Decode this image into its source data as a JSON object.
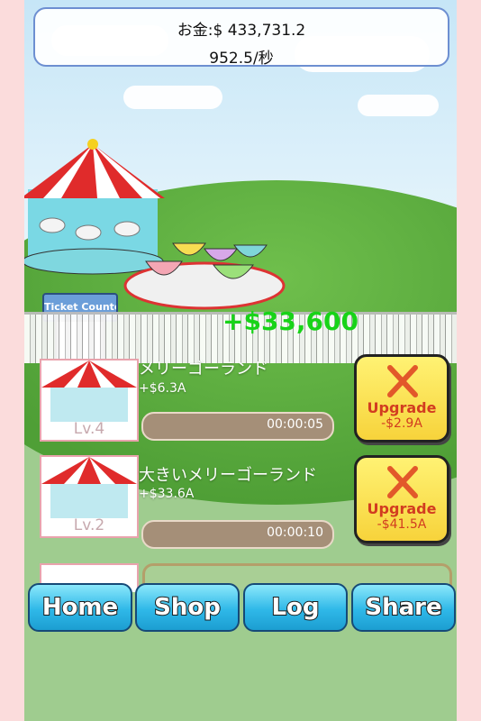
{
  "status": {
    "money_line": "お金:$ 433,731.2",
    "rate_line": "952.5/秒"
  },
  "park": {
    "ticket_sign": "Ticket Counter",
    "floating_gain": "+$33,600"
  },
  "attractions": [
    {
      "name": "メリーゴーランド",
      "income": "+$6.3A",
      "timer": "00:00:05",
      "level": "Lv.4",
      "upgrade_label": "Upgrade",
      "upgrade_cost": "-$2.9A"
    },
    {
      "name": "大きいメリーゴーランド",
      "income": "+$33.6A",
      "timer": "00:00:10",
      "level": "Lv.2",
      "upgrade_label": "Upgrade",
      "upgrade_cost": "-$41.5A"
    }
  ],
  "nav": {
    "home": "Home",
    "shop": "Shop",
    "log": "Log",
    "share": "Share"
  },
  "colors": {
    "money_text": "#111111",
    "gain_green": "#18d318",
    "upgrade_red": "#d23c20",
    "nav_blue": "#2fb8e8"
  }
}
